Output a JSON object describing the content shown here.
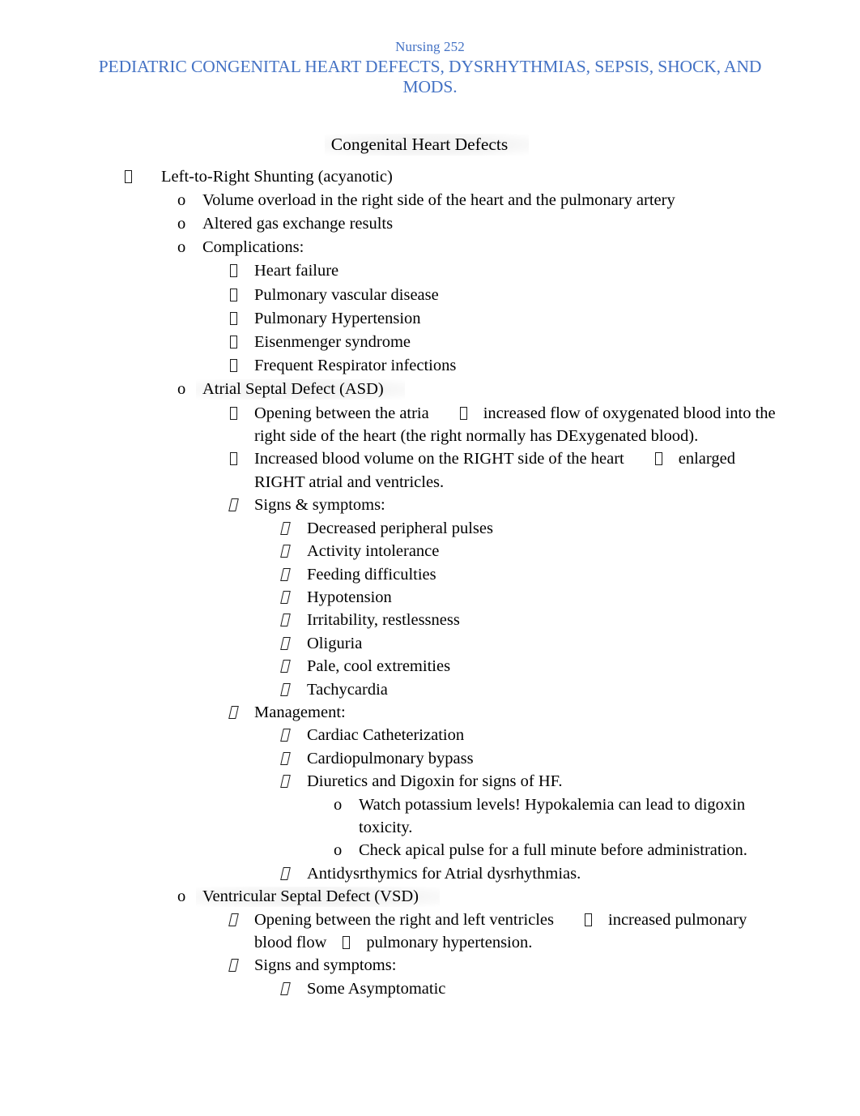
{
  "document": {
    "course": "Nursing 252",
    "title": "PEDIATRIC CONGENITAL HEART DEFECTS, DYSRHYTHMIAS, SEPSIS, SHOCK, AND MODS.",
    "section_heading": "Congenital Heart Defects",
    "title_color": "#4472C4",
    "highlight_color": "#F0F0F0",
    "body_color": "#000000"
  },
  "outline": {
    "l1_shunting": "Left-to-Right Shunting (acyanotic)",
    "l2_volume_overload": "Volume overload in the right side of the heart and the pulmonary artery",
    "l2_altered_gas": "Altered gas exchange results",
    "l2_complications": "Complications:",
    "complications": [
      "Heart failure",
      "Pulmonary vascular disease",
      "Pulmonary Hypertension",
      "Eisenmenger syndrome",
      "Frequent Respirator infections"
    ],
    "asd": {
      "heading": "Atrial Septal Defect (ASD)",
      "opening_a": "Opening between the atria",
      "opening_b": "increased flow of oxygenated blood into the right side of the heart (the right normally has DExygenated blood).",
      "volume_a": "Increased blood volume on the RIGHT side of the heart",
      "volume_b": "enlarged RIGHT atrial and ventricles.",
      "signs_label": "Signs & symptoms:",
      "signs": [
        "Decreased peripheral pulses",
        "Activity intolerance",
        "Feeding difficulties",
        "Hypotension",
        "Irritability, restlessness",
        "Oliguria",
        "Pale, cool extremities",
        "Tachycardia"
      ],
      "management_label": "Management:",
      "management": [
        "Cardiac Catheterization",
        "Cardiopulmonary bypass",
        "Diuretics and Digoxin for signs of HF."
      ],
      "digoxin_notes": [
        "Watch potassium levels! Hypokalemia can lead to digoxin toxicity.",
        "Check apical pulse for a full minute before administration."
      ],
      "antidysrhythmics": "Antidysrthymics for Atrial dysrhythmias."
    },
    "vsd": {
      "heading": "Ventricular Septal Defect (VSD)",
      "opening_a": "Opening between the right and left ventricles",
      "opening_b": "increased pulmonary blood flow",
      "opening_c": "pulmonary hypertension.",
      "signs_label": "Signs and symptoms:",
      "signs": [
        "Some Asymptomatic"
      ]
    }
  },
  "markers": {
    "level2": "o",
    "level4": "o",
    "level1_icon": "wingdings-box-icon",
    "level3_icon": "wingdings-box-icon",
    "bullet_icon": "wingdings-box-icon",
    "arrow_icon": "wingdings-arrow-box-icon"
  }
}
